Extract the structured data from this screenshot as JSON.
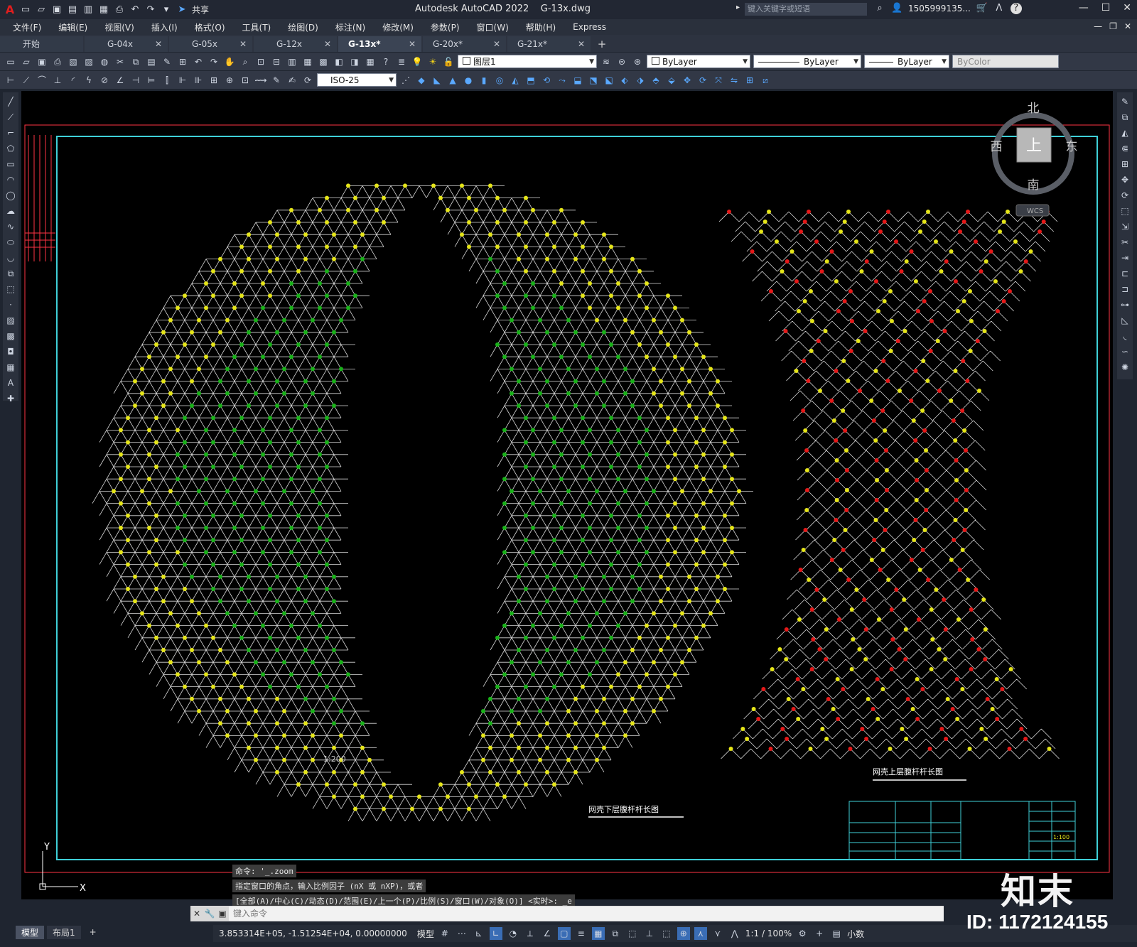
{
  "titlebar": {
    "app_name": "Autodesk AutoCAD 2022",
    "file_name": "G-13x.dwg",
    "share_label": "共享",
    "search_placeholder": "键入关键字或短语",
    "user_name": "1505999135...",
    "window_buttons": [
      "minimize",
      "maximize",
      "close"
    ]
  },
  "menubar": {
    "items": [
      "文件(F)",
      "编辑(E)",
      "视图(V)",
      "插入(I)",
      "格式(O)",
      "工具(T)",
      "绘图(D)",
      "标注(N)",
      "修改(M)",
      "参数(P)",
      "窗口(W)",
      "帮助(H)",
      "Express"
    ]
  },
  "tabs": [
    {
      "label": "开始",
      "closable": false,
      "active": false
    },
    {
      "label": "G-04x",
      "closable": true,
      "active": false
    },
    {
      "label": "G-05x",
      "closable": true,
      "active": false
    },
    {
      "label": "G-12x",
      "closable": true,
      "active": false
    },
    {
      "label": "G-13x*",
      "closable": true,
      "active": true
    },
    {
      "label": "G-20x*",
      "closable": true,
      "active": false
    },
    {
      "label": "G-21x*",
      "closable": true,
      "active": false
    }
  ],
  "toolbar": {
    "layer_value": "图层1",
    "color_value": "ByLayer",
    "linetype_value": "ByLayer",
    "lineweight_value": "ByLayer",
    "plotstyle_value": "ByColor",
    "dimstyle_value": "ISO-25"
  },
  "viewcube": {
    "north": "北",
    "south": "南",
    "east": "东",
    "west": "西",
    "top": "上",
    "wcs": "WCS"
  },
  "drawing": {
    "left_title": "网壳下层腹杆杆长图",
    "right_title": "网壳上层腹杆杆长图",
    "scale_note": "1:200",
    "ucs_y": "Y",
    "ucs_x": "X",
    "title_block_scale": "1:100",
    "colors": {
      "frame_red": "#ff3344",
      "frame_cyan": "#3fd0d8",
      "node_yellow": "#e6e619",
      "node_green": "#19b219",
      "node_red": "#e61919",
      "member": "#ffffff"
    }
  },
  "command": {
    "history": [
      "命令: '_.zoom",
      "指定窗口的角点，输入比例因子 (nX 或 nXP)，或者",
      "[全部(A)/中心(C)/动态(D)/范围(E)/上一个(P)/比例(S)/窗口(W)/对象(O)] <实时>: _e"
    ],
    "input_placeholder": "键入命令"
  },
  "layout_tabs": [
    "模型",
    "布局1"
  ],
  "statusbar": {
    "coordinates": "3.853314E+05, -1.51254E+04, 0.00000000",
    "model_label": "模型",
    "annotation_scale": "1:1 / 100%",
    "units": "小数"
  },
  "watermark": {
    "logo_text": "知末",
    "id_text": "ID: 1172124155"
  }
}
